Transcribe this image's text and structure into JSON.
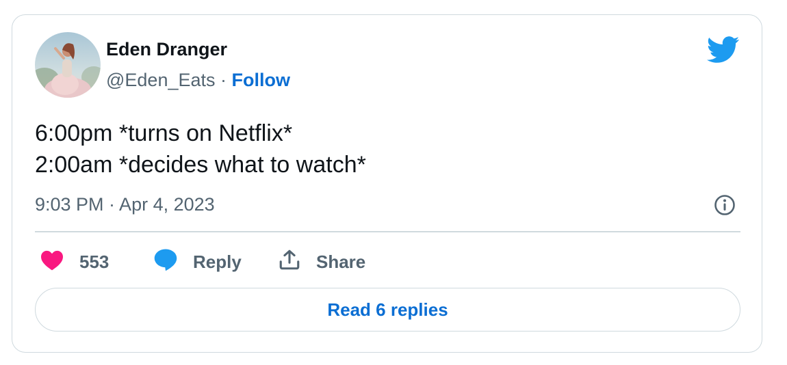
{
  "author": {
    "name": "Eden Dranger",
    "handle": "@Eden_Eats",
    "separator": "·",
    "follow_label": "Follow"
  },
  "tweet": {
    "lines": [
      "6:00pm *turns on Netflix*",
      "2:00am *decides what to watch*"
    ],
    "timestamp": "9:03 PM · Apr 4, 2023"
  },
  "actions": {
    "like_count": "553",
    "reply_label": "Reply",
    "share_label": "Share"
  },
  "read_replies_label": "Read 6 replies",
  "icons": {
    "brand": "twitter-bird-icon",
    "info": "info-icon",
    "like": "heart-icon",
    "reply": "speech-bubble-icon",
    "share": "share-upload-icon"
  },
  "colors": {
    "twitter_blue": "#1d9bf0",
    "link_blue": "#0b6ed3",
    "heart_pink": "#f91880",
    "text_primary": "#0f1419",
    "text_secondary": "#536471",
    "border": "#cfd9de"
  }
}
